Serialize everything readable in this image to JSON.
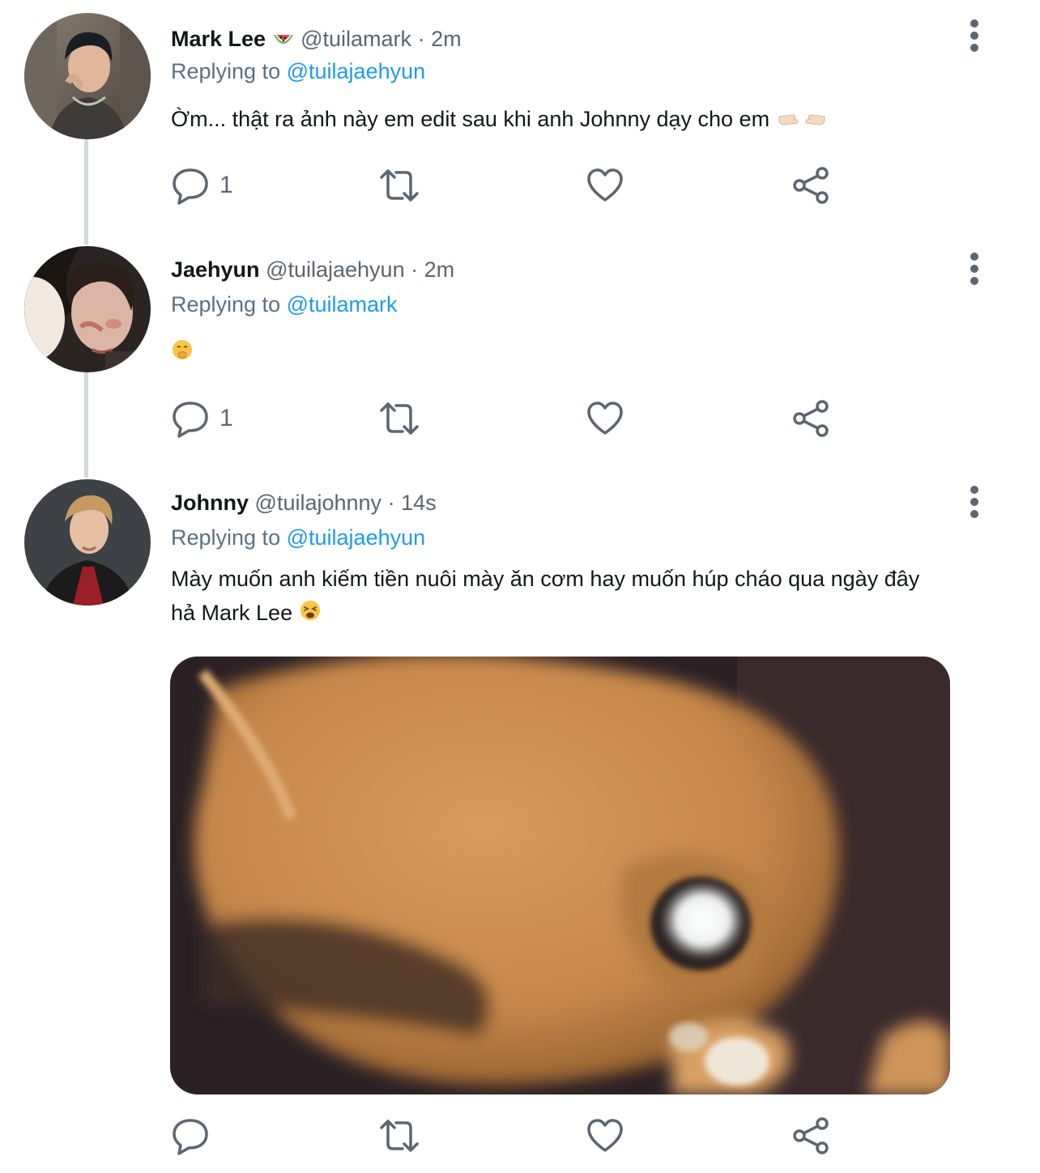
{
  "tweets": [
    {
      "name": "Mark Lee",
      "name_emoji": "🍉",
      "handle": "@tuilamark",
      "separator": "·",
      "time": "2m",
      "replying_prefix": "Replying to",
      "replying_to": "@tuilajaehyun",
      "text": "Ờm... thật ra ảnh này em edit sau khi anh Johnny dạy cho em",
      "text_emoji": "👉🏻👈🏻",
      "reply_count": "1"
    },
    {
      "name": "Jaehyun",
      "handle": "@tuilajaehyun",
      "separator": "·",
      "time": "2m",
      "replying_prefix": "Replying to",
      "replying_to": "@tuilamark",
      "text_emoji": "🤭",
      "reply_count": "1"
    },
    {
      "name": "Johnny",
      "handle": "@tuilajohnny",
      "separator": "·",
      "time": "14s",
      "replying_prefix": "Replying to",
      "replying_to": "@tuilajaehyun",
      "text_line1": "Mày muốn anh kiếm tiền nuôi mày ăn cơm hay muốn húp cháo qua ngày đây",
      "text_line2": "hả Mark Lee",
      "text_emoji": "😫",
      "reply_count": ""
    }
  ],
  "icons": {
    "reply": "reply-icon",
    "retweet": "retweet-icon",
    "like": "heart-icon",
    "share": "share-icon",
    "more": "more-vertical-icon"
  },
  "colors": {
    "link": "#1d9bf0",
    "muted": "#5b6670",
    "thread_line": "#cfd9de"
  }
}
